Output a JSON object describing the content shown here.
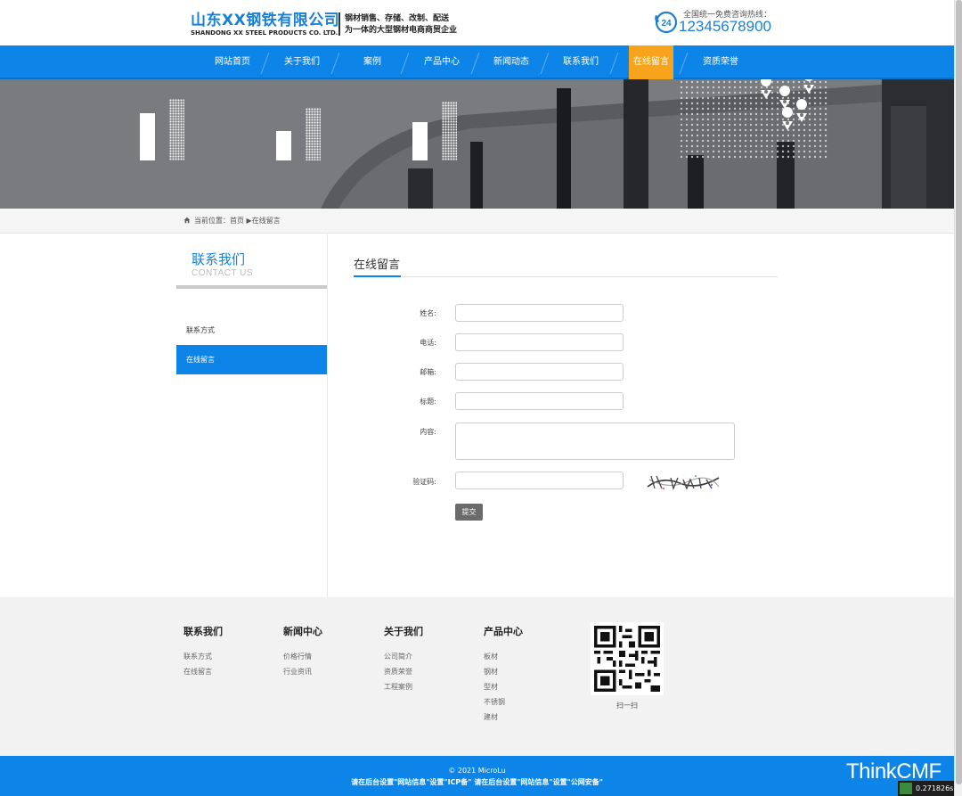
{
  "header": {
    "logo_cn": "山东XX钢铁有限公司",
    "logo_en": "SHANDONG XX STEEL PRODUCTS CO. LTD.",
    "slogan_line1": "钢材销售、存储、改制、配送",
    "slogan_line2": "为一体的大型钢材电商商贸企业",
    "hotline_label": "全国统一免费咨询热线：",
    "hotline_number": "12345678900",
    "hotline_badge": "24"
  },
  "nav": {
    "items": [
      {
        "label": "网站首页"
      },
      {
        "label": "关于我们"
      },
      {
        "label": "案例"
      },
      {
        "label": "产品中心"
      },
      {
        "label": "新闻动态"
      },
      {
        "label": "联系我们"
      },
      {
        "label": "在线留言"
      },
      {
        "label": "资质荣誉"
      }
    ],
    "active_index": 6
  },
  "breadcrumb": {
    "text": "当前位置：首页 ▶在线留言"
  },
  "sidebar": {
    "title": "联系我们",
    "subtitle": "CONTACT US",
    "items": [
      {
        "label": "联系方式"
      },
      {
        "label": "在线留言"
      }
    ]
  },
  "content": {
    "title": "在线留言"
  },
  "form": {
    "name_label": "姓名:",
    "phone_label": "电话:",
    "email_label": "邮箱:",
    "subject_label": "标题:",
    "message_label": "内容:",
    "captcha_label": "验证码:",
    "name_value": "",
    "phone_value": "",
    "email_value": "",
    "subject_value": "",
    "message_value": "",
    "captcha_value": "",
    "submit_label": "提交"
  },
  "footer": {
    "columns": [
      {
        "title": "联系我们",
        "links": [
          "联系方式",
          "在线留言"
        ]
      },
      {
        "title": "新闻中心",
        "links": [
          "价格行情",
          "行业资讯"
        ]
      },
      {
        "title": "关于我们",
        "links": [
          "公司简介",
          "资质荣誉",
          "工程案例"
        ]
      },
      {
        "title": "产品中心",
        "links": [
          "板材",
          "钢材",
          "型材",
          "不锈钢",
          "建材"
        ]
      }
    ],
    "qr_label": "扫一扫"
  },
  "bottom": {
    "copyright": "© 2021 MicroLu",
    "icp": "请在后台设置\"网站信息\"设置\"ICP备\" 请在后台设置\"网站信息\"设置\"公网安备\""
  },
  "overlay": {
    "brand": "ThinkCMF",
    "time": "0.271826s"
  },
  "colors": {
    "primary": "#0d85e8",
    "active_nav": "#f7a41c",
    "submit": "#6b6b6b"
  }
}
